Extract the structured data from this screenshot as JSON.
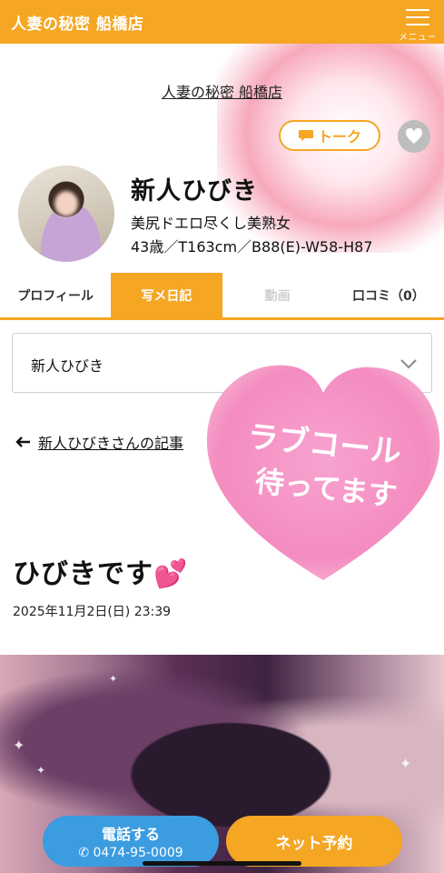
{
  "header": {
    "shop_title": "人妻の秘密 船橋店",
    "menu_label": "メニュー"
  },
  "profile": {
    "shop_link": "人妻の秘密 船橋店",
    "talk_label": "トーク",
    "name": "新人ひびき",
    "catchphrase": "美尻ドエロ尽くし美熟女",
    "specs": "43歳／T163cm／B88(E)-W58-H87"
  },
  "tabs": [
    {
      "label": "プロフィール",
      "state": "normal"
    },
    {
      "label": "写メ日記",
      "state": "active"
    },
    {
      "label": "動画",
      "state": "disabled"
    },
    {
      "label": "口コミ（0）",
      "state": "normal"
    }
  ],
  "selector": {
    "value": "新人ひびき"
  },
  "back_link": {
    "label": "新人ひびきさんの記事"
  },
  "sticker": {
    "line1": "ラブコール",
    "line2": "待ってます"
  },
  "post": {
    "title": "ひびきです💕",
    "date": "2025年11月2日(日) 23:39"
  },
  "actions": {
    "call_label": "電話する",
    "phone": "0474-95-0009",
    "book_label": "ネット予約"
  },
  "colors": {
    "accent": "#f5a623",
    "call": "#3b9ce0",
    "heart_sticker": "#f48cc0"
  },
  "icons": [
    "menu-icon",
    "speech-bubble-icon",
    "heart-icon",
    "chevron-down-icon",
    "arrow-left-icon",
    "phone-icon"
  ]
}
